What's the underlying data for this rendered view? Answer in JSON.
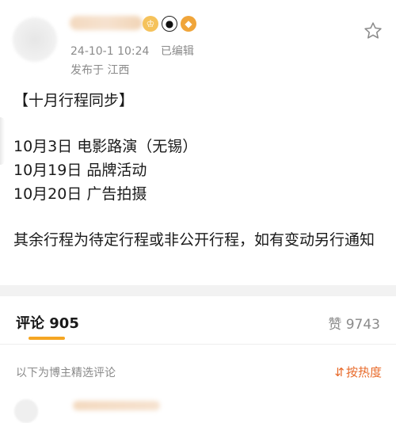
{
  "post": {
    "badges": [
      "crown-badge",
      "panda-badge",
      "fish-badge"
    ],
    "timestamp": "24-10-1 10:24",
    "edited": "已编辑",
    "location": "发布于 江西",
    "title_line": "【十月行程同步】",
    "schedule": [
      "10月3日 电影路演（无锡）",
      "10月19日 品牌活动",
      "10月20日 广告拍摄"
    ],
    "note": "其余行程为待定行程或非公开行程，如有变动另行通知"
  },
  "tabs": {
    "comments_label": "评论 905",
    "likes_label": "赞 9743"
  },
  "comments": {
    "curated_label": "以下为博主精选评论",
    "sort_label": "按热度",
    "sort_icon": "⇵"
  },
  "colors": {
    "accent": "#f5a623",
    "sort_accent": "#e86a2a",
    "meta_gray": "#8a8a8a"
  }
}
